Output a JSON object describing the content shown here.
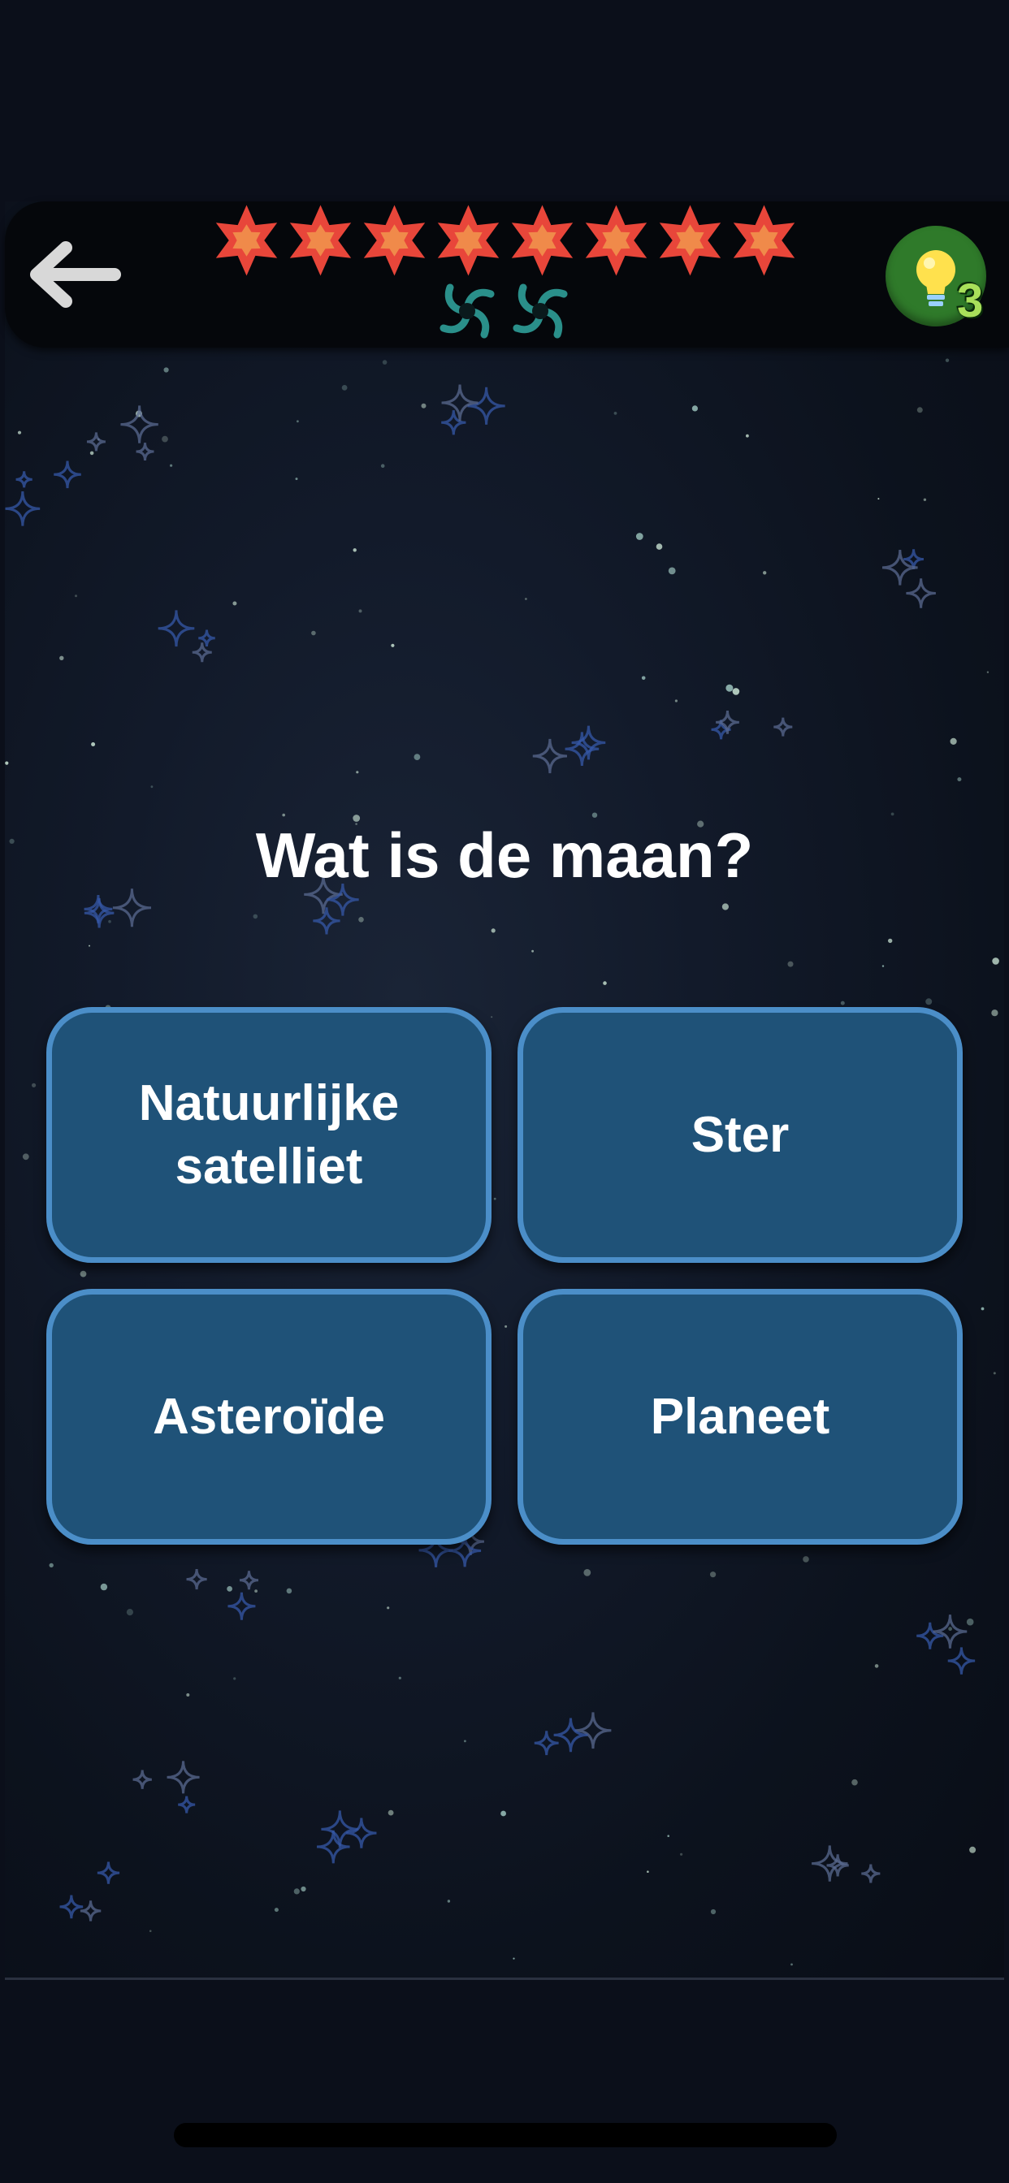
{
  "header": {
    "back_icon": "arrow-left-icon",
    "progress_stars": 8,
    "star_icon": "red-star-icon",
    "bonus_spirals": 2,
    "spiral_icon": "galaxy-spiral-icon",
    "hint_icon": "lightbulb-icon",
    "hint_count": "3"
  },
  "question": {
    "text": "Wat is de maan?"
  },
  "answers": [
    {
      "label": "Natuurlijke satelliet"
    },
    {
      "label": "Ster"
    },
    {
      "label": "Asteroïde"
    },
    {
      "label": "Planeet"
    }
  ],
  "colors": {
    "background": "#0b0f1a",
    "answer_fill": "#1f5278",
    "answer_border": "#4b8ec8",
    "star_red": "#e8463a",
    "star_orange": "#f08a4a",
    "spiral_teal": "#2a8f8a",
    "hint_green": "#2f7a2a",
    "hint_count_green": "#a8e05a"
  }
}
